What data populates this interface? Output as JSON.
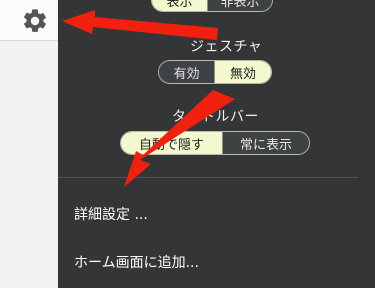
{
  "settings_button": {
    "icon": "gear-icon"
  },
  "display_toggle": {
    "on_label": "表示",
    "off_label": "非表示",
    "selected": "on"
  },
  "gesture": {
    "label": "ジェスチャ",
    "options": [
      "有効",
      "無効"
    ],
    "selected": "無効"
  },
  "titlebar": {
    "label": "タイトルバー",
    "options": [
      "自動で隠す",
      "常に表示"
    ],
    "selected": "自動で隠す"
  },
  "menu": {
    "advanced_label": "詳細設定 ...",
    "add_home_label": "ホーム画面に追加..."
  },
  "colors": {
    "panel_bg": "#333537",
    "selected_segment": "#f4f8cf",
    "annotation_arrow": "#f1200f"
  }
}
